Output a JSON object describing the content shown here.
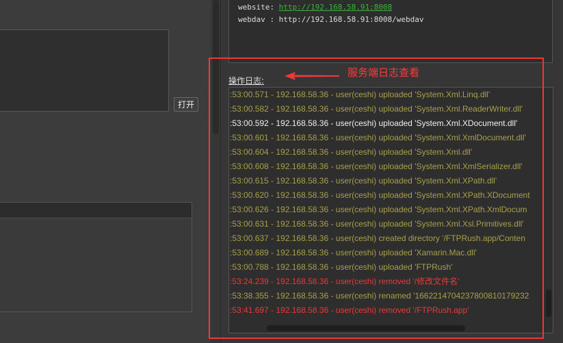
{
  "left": {
    "open_button": "打开"
  },
  "info": {
    "website_label": "website: ",
    "website_url": "http://192.168.58.91:8008",
    "webdav_line": "webdav : http://192.168.58.91:8008/webdav"
  },
  "log": {
    "label": "操作日志:",
    "lines": [
      {
        "text": ":53:00.571 - 192.168.58.36 - user(ceshi) uploaded 'System.Xml.Linq.dll'",
        "color": "#a8a04a"
      },
      {
        "text": ":53:00.582 - 192.168.58.36 - user(ceshi) uploaded 'System.Xml.ReaderWriter.dll'",
        "color": "#a8a04a"
      },
      {
        "text": ":53:00.592 - 192.168.58.36 - user(ceshi) uploaded 'System.Xml.XDocument.dll'",
        "color": "#f0f0f0"
      },
      {
        "text": ":53:00.601 - 192.168.58.36 - user(ceshi) uploaded 'System.Xml.XmlDocument.dll'",
        "color": "#a8a04a"
      },
      {
        "text": ":53:00.604 - 192.168.58.36 - user(ceshi) uploaded 'System.Xml.dll'",
        "color": "#a8a04a"
      },
      {
        "text": ":53:00.608 - 192.168.58.36 - user(ceshi) uploaded 'System.Xml.XmlSerializer.dll'",
        "color": "#a8a04a"
      },
      {
        "text": ":53:00.615 - 192.168.58.36 - user(ceshi) uploaded 'System.Xml.XPath.dll'",
        "color": "#a8a04a"
      },
      {
        "text": ":53:00.620 - 192.168.58.36 - user(ceshi) uploaded 'System.Xml.XPath.XDocument",
        "color": "#a8a04a"
      },
      {
        "text": ":53:00.626 - 192.168.58.36 - user(ceshi) uploaded 'System.Xml.XPath.XmlDocum",
        "color": "#a8a04a"
      },
      {
        "text": ":53:00.631 - 192.168.58.36 - user(ceshi) uploaded 'System.Xml.Xsl.Primitives.dll'",
        "color": "#a8a04a"
      },
      {
        "text": ":53:00.637 - 192.168.58.36 - user(ceshi) created directory '/FTPRush.app/Conten",
        "color": "#a8a04a"
      },
      {
        "text": ":53:00.689 - 192.168.58.36 - user(ceshi) uploaded 'Xamarin.Mac.dll'",
        "color": "#a8a04a"
      },
      {
        "text": ":53:00.788 - 192.168.58.36 - user(ceshi) uploaded 'FTPRush'",
        "color": "#a8a04a"
      },
      {
        "text": ":53:24.239 - 192.168.58.36 - user(ceshi) removed '/修改文件名'",
        "color": "#e83a3a"
      },
      {
        "text": ":53:38.355 - 192.168.58.36 - user(ceshi) renamed '1662214704237800810179232",
        "color": "#a8a04a"
      },
      {
        "text": ":53:41.697 - 192.168.58.36 - user(ceshi) removed '/FTPRush.app'",
        "color": "#e83a3a"
      }
    ]
  },
  "annotation": {
    "text": "服务端日志查看",
    "color": "#f03838"
  }
}
